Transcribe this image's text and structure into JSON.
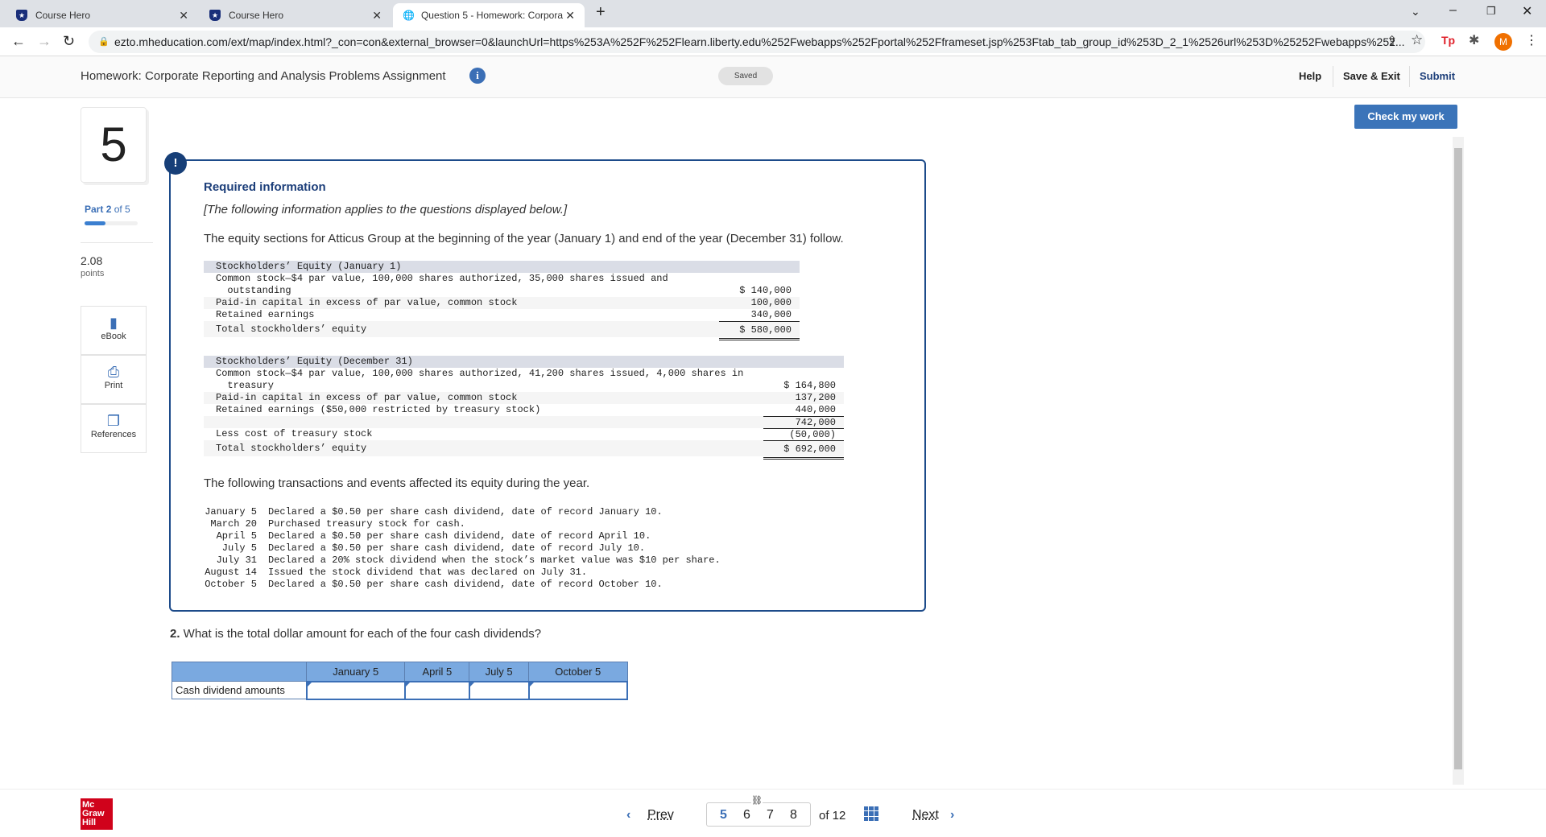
{
  "browser": {
    "tabs": [
      {
        "title": "Course Hero"
      },
      {
        "title": "Course Hero"
      },
      {
        "title": "Question 5 - Homework: Corpora"
      }
    ],
    "url": "ezto.mheducation.com/ext/map/index.html?_con=con&external_browser=0&launchUrl=https%253A%252F%252Flearn.liberty.edu%252Fwebapps%252Fportal%252Fframeset.jsp%253Ftab_tab_group_id%253D_2_1%2526url%253D%25252Fwebapps%252...",
    "profile_initial": "M",
    "ext_label": "Tp"
  },
  "header": {
    "title": "Homework: Corporate Reporting and Analysis Problems Assignment",
    "status": "Saved",
    "help": "Help",
    "save_exit": "Save & Exit",
    "submit": "Submit",
    "check": "Check my work"
  },
  "sidebar": {
    "question_number": "5",
    "part_label": "Part",
    "part_num": "2",
    "part_of": "of 5",
    "part_progress": 0.4,
    "points": "2.08",
    "points_label": "points",
    "tools": [
      {
        "label": "eBook",
        "icon": "book-icon"
      },
      {
        "label": "Print",
        "icon": "printer-icon"
      },
      {
        "label": "References",
        "icon": "copy-icon"
      }
    ]
  },
  "info": {
    "badge": "!",
    "title": "Required information",
    "note": "[The following information applies to the questions displayed below.]",
    "intro": "The equity sections for Atticus Group at the beginning of the year (January 1) and end of the year (December 31) follow.",
    "jan": {
      "heading": "Stockholders’ Equity (January 1)",
      "rows": [
        {
          "label": "Common stock—$4 par value, 100,000 shares authorized, 35,000 shares issued and",
          "value": ""
        },
        {
          "label": "  outstanding",
          "value": "$ 140,000"
        },
        {
          "label": "Paid-in capital in excess of par value, common stock",
          "value": "100,000"
        },
        {
          "label": "Retained earnings",
          "value": "340,000"
        },
        {
          "label": "Total stockholders’ equity",
          "value": "$ 580,000"
        }
      ]
    },
    "dec": {
      "heading": "Stockholders’ Equity (December 31)",
      "rows": [
        {
          "label": "Common stock—$4 par value, 100,000 shares authorized, 41,200 shares issued, 4,000 shares in",
          "value": ""
        },
        {
          "label": "  treasury",
          "value": "$ 164,800"
        },
        {
          "label": "Paid-in capital in excess of par value, common stock",
          "value": "137,200"
        },
        {
          "label": "Retained earnings ($50,000 restricted by treasury stock)",
          "value": "440,000"
        },
        {
          "label": "",
          "value": "742,000"
        },
        {
          "label": "Less cost of treasury stock",
          "value": "(50,000)"
        },
        {
          "label": "Total stockholders’ equity",
          "value": "$ 692,000"
        }
      ]
    },
    "transactions_intro": "The following transactions and events affected its equity during the year.",
    "transactions": [
      {
        "date": "January 5",
        "text": "Declared a $0.50 per share cash dividend, date of record January 10."
      },
      {
        "date": "March 20",
        "text": "Purchased treasury stock for cash."
      },
      {
        "date": "April 5",
        "text": "Declared a $0.50 per share cash dividend, date of record April 10."
      },
      {
        "date": "July 5",
        "text": "Declared a $0.50 per share cash dividend, date of record July 10."
      },
      {
        "date": "July 31",
        "text": "Declared a 20% stock dividend when the stock’s market value was $10 per share."
      },
      {
        "date": "August 14",
        "text": "Issued the stock dividend that was declared on July 31."
      },
      {
        "date": "October 5",
        "text": "Declared a $0.50 per share cash dividend, date of record October 10."
      }
    ]
  },
  "question": {
    "num": "2.",
    "text": " What is the total dollar amount for each of the four cash dividends?",
    "columns": [
      "January 5",
      "April 5",
      "July 5",
      "October 5"
    ],
    "row_label": "Cash dividend amounts",
    "values": [
      "",
      "",
      "",
      ""
    ]
  },
  "footer": {
    "logo": "Mc Graw Hill",
    "prev": "Prev",
    "next": "Next",
    "pages": [
      "5",
      "6",
      "7",
      "8"
    ],
    "current": "5",
    "of": "of 12"
  }
}
